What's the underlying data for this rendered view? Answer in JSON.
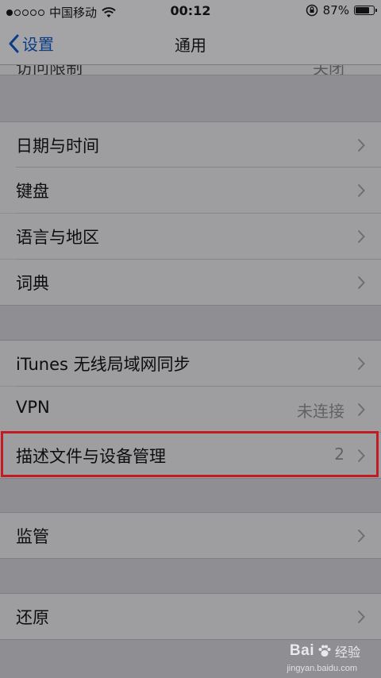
{
  "statusbar": {
    "carrier": "中国移动",
    "time": "00:12",
    "battery_percent": "87%",
    "battery_level": 0.87,
    "signal_dots_filled": 1,
    "signal_dots_total": 5
  },
  "navbar": {
    "back_label": "设置",
    "title": "通用"
  },
  "partial_row": {
    "label": "访问限制",
    "value": "关闭"
  },
  "rows": [
    {
      "label": "日期与时间",
      "value": ""
    },
    {
      "label": "键盘",
      "value": ""
    },
    {
      "label": "语言与地区",
      "value": ""
    },
    {
      "label": "词典",
      "value": ""
    },
    {
      "label": "iTunes 无线局域网同步",
      "value": ""
    },
    {
      "label": "VPN",
      "value": "未连接"
    },
    {
      "label": "描述文件与设备管理",
      "value": "2"
    },
    {
      "label": "监管",
      "value": ""
    },
    {
      "label": "还原",
      "value": ""
    }
  ],
  "watermark": {
    "main": "Bai",
    "suffix": "经验",
    "sub": "jingyan.baidu.com"
  },
  "colors": {
    "highlight": "#c21b21",
    "link": "#0a3d86"
  }
}
